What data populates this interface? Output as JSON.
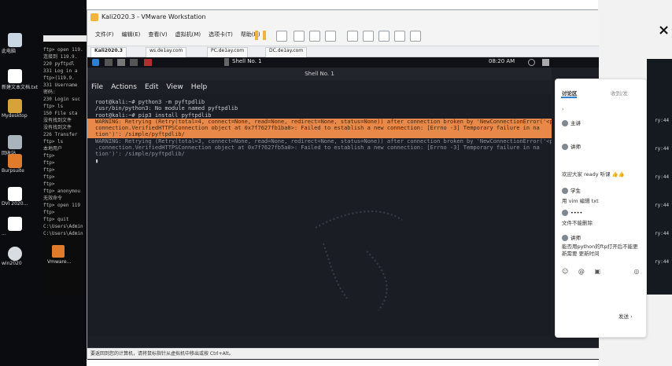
{
  "host_desktop": {
    "icons": [
      {
        "label": "此电脑",
        "icon": "computer-icon",
        "color": "#c9d6e3"
      },
      {
        "label": "新建文本文档.txt",
        "icon": "text-file-icon",
        "color": "#ffffff"
      },
      {
        "label": "Mydesktop",
        "icon": "folder-icon",
        "color": "#d8a23a"
      },
      {
        "label": "回收站",
        "icon": "recycle-bin-icon",
        "color": "#aab4bd"
      },
      {
        "label": "Burpsuite",
        "icon": "burp-icon",
        "color": "#e07b2c"
      },
      {
        "label": "DVI 2020...",
        "icon": "document-icon",
        "color": "#ffffff"
      },
      {
        "label": "...",
        "icon": "document-icon",
        "color": "#ffffff"
      },
      {
        "label": "win2020",
        "icon": "app-icon",
        "color": "#d8dde2"
      },
      {
        "label": "Vmware...",
        "icon": "vmware-icon",
        "color": "#e07b2c"
      },
      {
        "label": "config.txt",
        "icon": "text-file-icon",
        "color": "#ffffff"
      }
    ]
  },
  "host_terminal": {
    "lines": [
      "ftp> open 119.",
      "连接到 119.9.",
      "220 pyftpdl",
      "331 Log in a",
      "ftp>(119.9.",
      "331 Username",
      "密码:",
      "230 Login suc",
      "ftp> ls",
      "150 File sta",
      "没有找到文件",
      "没有找到文件",
      "226 Transfer",
      "ftp> ls",
      "本地用户",
      "ftp>",
      "ftp>",
      "ftp>",
      "ftp>",
      "ftp>",
      "ftp> anonymou",
      "无效命令",
      "ftp> open 119",
      "ftp>",
      "ftp> quit",
      "",
      "C:\\Users\\Admin",
      "",
      "C:\\Users\\Admin"
    ]
  },
  "vmware": {
    "title": "Kali2020.3 - VMware Workstation",
    "menu": [
      "文件(F)",
      "编辑(E)",
      "查看(V)",
      "虚拟机(M)",
      "选项卡(T)",
      "帮助(H)"
    ],
    "tabs": [
      "Kali2020.3",
      "ws.de1ay.com",
      "PC.de1ay.com",
      "DC.de1ay.com"
    ],
    "status_text": "要返回到您的计算机，请将鼠标指针从虚拟机中移出或按 Ctrl+Alt。"
  },
  "kali_panel": {
    "title": "Shell No. 1",
    "time": "08:20 AM"
  },
  "terminal": {
    "title": "Shell No. 1",
    "menu": [
      "File",
      "Actions",
      "Edit",
      "View",
      "Help"
    ],
    "lines": [
      {
        "text": "root@kali:~# python3 -m pyftpdlib",
        "style": "normal"
      },
      {
        "text": "/usr/bin/python3: No module named pyftpdlib",
        "style": "normal"
      },
      {
        "text": "root@kali:~# pip3 install pyftpdlib",
        "style": "normal"
      },
      {
        "text": "WARNING: Retrying (Retry(total=4, connect=None, read=None, redirect=None, status=None)) after connection broken by 'NewConnectionError('<pip._vendor.urllib3",
        "style": "warn"
      },
      {
        "text": "connection.VerifiedHTTPSConnection object at 0x7f7627fb1ba0>: Failed to establish a new connection: [Errno -3] Temporary failure in na",
        "style": "warn"
      },
      {
        "text": "tion')': /simple/pyftpdlib/",
        "style": "warn"
      },
      {
        "text": "WARNING: Retrying (Retry(total=3, connect=None, read=None, redirect=None, status=None)) after connection broken by 'NewConnectionError('<pi",
        "style": "dim"
      },
      {
        "text": ".connection.VerifiedHTTPSConnection object at 0x7f7627fb5a0>: Failed to establish a new connection: [Errno -3] Temporary failure in na",
        "style": "dim"
      },
      {
        "text": "tion')': /simple/pyftpdlib/",
        "style": "dim"
      },
      {
        "text": "▮",
        "style": "normal"
      }
    ]
  },
  "chat": {
    "tabs": [
      "讨论区",
      "收到/发"
    ],
    "messages": [
      {
        "name": "主讲",
        "text": ""
      },
      {
        "name": "讲师",
        "text": ""
      },
      {
        "name": "",
        "text": "欢迎大家 ready 听课 👍👍"
      },
      {
        "name": "学生",
        "text": "用 vim 编辑 txt"
      },
      {
        "name": "••••",
        "text": "文件不能删除"
      },
      {
        "name": "讲师",
        "text": "能否用python的ftp打开后不能更新需要 更新时间"
      }
    ],
    "footer_icons": [
      "emoji-icon",
      "at-icon",
      "image-icon",
      "send-icon"
    ],
    "send_label": "发送"
  },
  "right_dark": {
    "lines": [
      "ry:44",
      "ry:44",
      "ry:44",
      "ry:44",
      "ry:44",
      "ry:44"
    ]
  },
  "colors": {
    "warn": "#e8894a",
    "kali_bg": "#1a1d24",
    "vm_accent": "#f0b43c"
  }
}
